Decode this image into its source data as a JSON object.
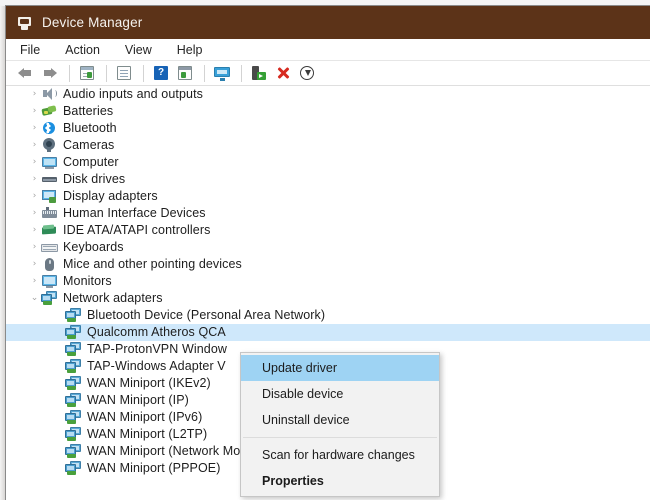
{
  "window": {
    "title": "Device Manager",
    "title_icon": "device-manager-icon",
    "titlebar_color": "#5c3318"
  },
  "menubar": {
    "items": [
      {
        "label": "File"
      },
      {
        "label": "Action"
      },
      {
        "label": "View"
      },
      {
        "label": "Help"
      }
    ]
  },
  "toolbar": {
    "buttons": [
      {
        "icon": "back-arrow-icon"
      },
      {
        "icon": "forward-arrow-icon"
      },
      {
        "icon": "show-hide-console-tree-icon"
      },
      {
        "icon": "properties-icon"
      },
      {
        "icon": "help-icon"
      },
      {
        "icon": "view-details-icon"
      },
      {
        "icon": "scan-for-hardware-changes-icon"
      },
      {
        "icon": "update-driver-icon"
      },
      {
        "icon": "uninstall-device-icon"
      },
      {
        "icon": "disable-device-icon"
      }
    ]
  },
  "tree": {
    "items": [
      {
        "label": "Audio inputs and outputs",
        "icon": "speaker-icon",
        "state": "collapsed",
        "indent": 1
      },
      {
        "label": "Batteries",
        "icon": "battery-icon",
        "state": "collapsed",
        "indent": 1
      },
      {
        "label": "Bluetooth",
        "icon": "bluetooth-icon",
        "state": "collapsed",
        "indent": 1
      },
      {
        "label": "Cameras",
        "icon": "camera-icon",
        "state": "collapsed",
        "indent": 1
      },
      {
        "label": "Computer",
        "icon": "computer-icon",
        "state": "collapsed",
        "indent": 1
      },
      {
        "label": "Disk drives",
        "icon": "disk-drive-icon",
        "state": "collapsed",
        "indent": 1
      },
      {
        "label": "Display adapters",
        "icon": "display-adapter-icon",
        "state": "collapsed",
        "indent": 1
      },
      {
        "label": "Human Interface Devices",
        "icon": "hid-icon",
        "state": "collapsed",
        "indent": 1
      },
      {
        "label": "IDE ATA/ATAPI controllers",
        "icon": "ide-controller-icon",
        "state": "collapsed",
        "indent": 1
      },
      {
        "label": "Keyboards",
        "icon": "keyboard-icon",
        "state": "collapsed",
        "indent": 1
      },
      {
        "label": "Mice and other pointing devices",
        "icon": "mouse-icon",
        "state": "collapsed",
        "indent": 1
      },
      {
        "label": "Monitors",
        "icon": "monitor-icon",
        "state": "collapsed",
        "indent": 1
      },
      {
        "label": "Network adapters",
        "icon": "network-adapter-icon",
        "state": "expanded",
        "indent": 1
      },
      {
        "label": "Bluetooth Device (Personal Area Network)",
        "icon": "network-adapter-icon",
        "state": "leaf",
        "indent": 2
      },
      {
        "label": "Qualcomm Atheros QCA",
        "icon": "network-adapter-icon",
        "state": "leaf",
        "indent": 2,
        "selected": true
      },
      {
        "label": "TAP-ProtonVPN Window",
        "icon": "network-adapter-icon",
        "state": "leaf",
        "indent": 2
      },
      {
        "label": "TAP-Windows Adapter V",
        "icon": "network-adapter-icon",
        "state": "leaf",
        "indent": 2
      },
      {
        "label": "WAN Miniport (IKEv2)",
        "icon": "network-adapter-icon",
        "state": "leaf",
        "indent": 2
      },
      {
        "label": "WAN Miniport (IP)",
        "icon": "network-adapter-icon",
        "state": "leaf",
        "indent": 2
      },
      {
        "label": "WAN Miniport (IPv6)",
        "icon": "network-adapter-icon",
        "state": "leaf",
        "indent": 2
      },
      {
        "label": "WAN Miniport (L2TP)",
        "icon": "network-adapter-icon",
        "state": "leaf",
        "indent": 2
      },
      {
        "label": "WAN Miniport (Network Monitor)",
        "icon": "network-adapter-icon",
        "state": "leaf",
        "indent": 2
      },
      {
        "label": "WAN Miniport (PPPOE)",
        "icon": "network-adapter-icon",
        "state": "leaf",
        "indent": 2
      }
    ],
    "selection_color": "#cfe8fb",
    "collapsed_glyph": "›",
    "expanded_glyph": "⌄"
  },
  "context_menu": {
    "highlight_color": "#9ed3f3",
    "items": [
      {
        "label": "Update driver",
        "highlighted": true,
        "bold": false
      },
      {
        "label": "Disable device",
        "highlighted": false,
        "bold": false
      },
      {
        "label": "Uninstall device",
        "highlighted": false,
        "bold": false
      },
      {
        "separator": true
      },
      {
        "label": "Scan for hardware changes",
        "highlighted": false,
        "bold": false
      },
      {
        "label": "Properties",
        "highlighted": false,
        "bold": true
      }
    ]
  }
}
